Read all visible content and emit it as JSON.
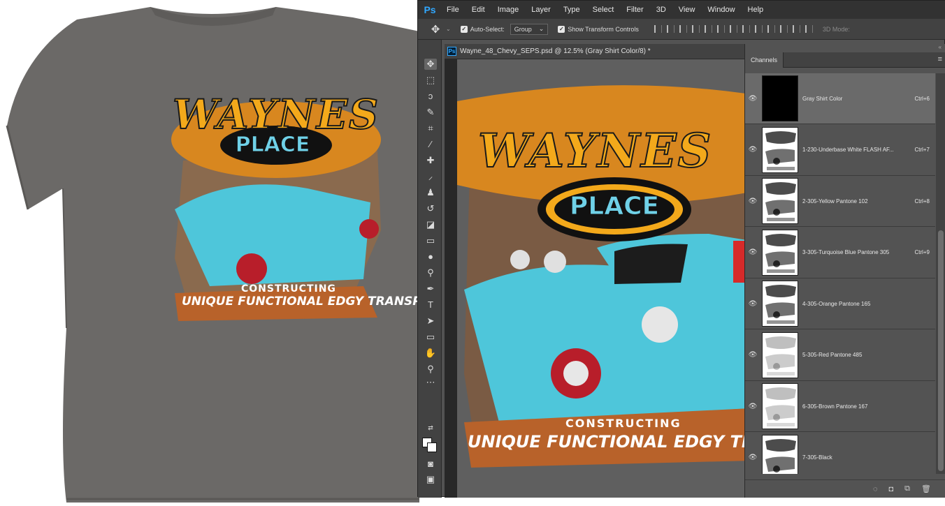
{
  "app": {
    "logo": "Ps",
    "menu": [
      "File",
      "Edit",
      "Image",
      "Layer",
      "Type",
      "Select",
      "Filter",
      "3D",
      "View",
      "Window",
      "Help"
    ]
  },
  "options": {
    "auto_select_label": "Auto-Select:",
    "auto_select_checked": true,
    "group_value": "Group",
    "show_transform_label": "Show Transform Controls",
    "show_transform_checked": true,
    "mode_3d": "3D Mode:"
  },
  "document": {
    "tab_title": "Wayne_48_Chevy_SEPS.psd @ 12.5% (Gray Shirt Color/8) *"
  },
  "artwork": {
    "logo": "WAYNES",
    "place": "PLACE",
    "constructing": "CONSTRUCTING",
    "tagline": "UNIQUE FUNCTIONAL EDGY TRANSPORTATION",
    "tagline_cropped": "UNIQUE FUNCTIONAL EDGY TRANSPORTA"
  },
  "channels_panel": {
    "tab_label": "Channels",
    "channels": [
      {
        "name": "Gray Shirt Color",
        "shortcut": "Ctrl+6",
        "thumb": "black",
        "selected": true
      },
      {
        "name": "1-230-Underbase White FLASH AF...",
        "shortcut": "Ctrl+7",
        "thumb": "art",
        "selected": false
      },
      {
        "name": "2-305-Yellow Pantone 102",
        "shortcut": "Ctrl+8",
        "thumb": "art",
        "selected": false
      },
      {
        "name": "3-305-Turquoise Blue Pantone 305",
        "shortcut": "Ctrl+9",
        "thumb": "art",
        "selected": false
      },
      {
        "name": "4-305-Orange Pantone 165",
        "shortcut": "",
        "thumb": "art",
        "selected": false
      },
      {
        "name": "5-305-Red Pantone 485",
        "shortcut": "",
        "thumb": "light",
        "selected": false
      },
      {
        "name": "6-305-Brown Pantone 167",
        "shortcut": "",
        "thumb": "light",
        "selected": false
      },
      {
        "name": "7-305-Black",
        "shortcut": "",
        "thumb": "art",
        "selected": false
      }
    ]
  },
  "colors": {
    "ps_blue": "#31a8ff",
    "shirt_gray": "#6b6967",
    "panel_bg": "#535353"
  }
}
